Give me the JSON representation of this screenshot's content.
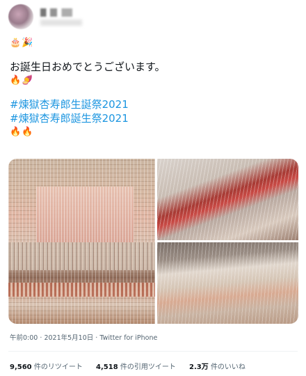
{
  "tweet": {
    "emoji_top": "🎂🎉",
    "greeting": "お誕生日おめでとうございます。",
    "emoji_mid": "🔥🍠",
    "hashtags": [
      "#煉獄杏寿郎生誕祭2021",
      "#煉獄杏寿郎誕生祭2021"
    ],
    "emoji_bottom": "🔥🔥",
    "images": [
      "photo-1",
      "photo-2",
      "photo-3",
      "photo-4"
    ]
  },
  "meta": {
    "time": "午前0:00",
    "separator": "·",
    "date": "2021年5月10日",
    "source": "Twitter for iPhone"
  },
  "stats": {
    "retweets_num": "9,560",
    "retweets_label": "件のリツイート",
    "quotes_num": "4,518",
    "quotes_label": "件の引用ツイート",
    "likes_num": "2.3万",
    "likes_label": "件のいいね"
  }
}
